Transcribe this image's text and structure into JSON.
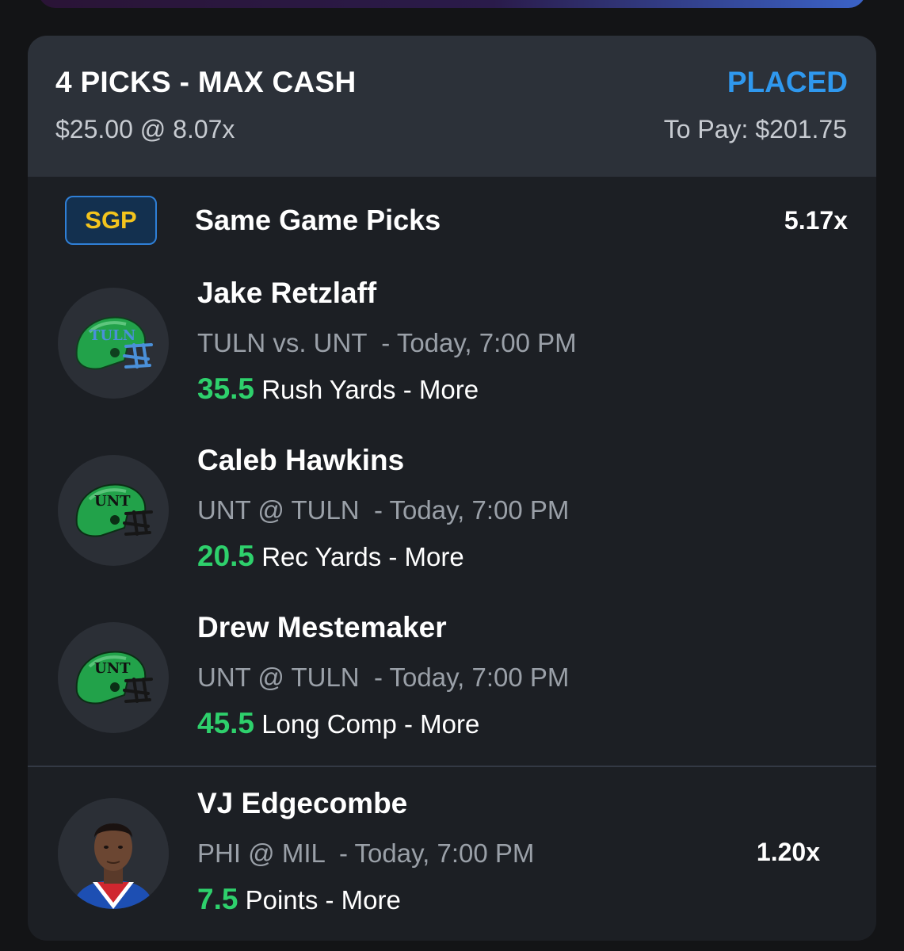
{
  "entry": {
    "title": "4 PICKS - MAX CASH",
    "wager": "$25.00 @ 8.07x",
    "status": "PLACED",
    "to_pay": "To Pay: $201.75"
  },
  "sgp": {
    "badge": "SGP",
    "title": "Same Game Picks",
    "multiplier": "5.17x"
  },
  "picks": [
    {
      "player": "Jake Retzlaff",
      "team_icon": "tuln-helmet",
      "matchup": "TULN vs. UNT",
      "time": "Today, 7:00 PM",
      "line": "35.5",
      "stat": "Rush Yards",
      "direction": "More"
    },
    {
      "player": "Caleb Hawkins",
      "team_icon": "unt-helmet",
      "matchup": "UNT @ TULN",
      "time": "Today, 7:00 PM",
      "line": "20.5",
      "stat": "Rec Yards",
      "direction": "More"
    },
    {
      "player": "Drew Mestemaker",
      "team_icon": "unt-helmet",
      "matchup": "UNT @ TULN",
      "time": "Today, 7:00 PM",
      "line": "45.5",
      "stat": "Long Comp",
      "direction": "More"
    },
    {
      "player": "VJ Edgecombe",
      "team_icon": "player-headshot",
      "matchup": "PHI @ MIL",
      "time": "Today, 7:00 PM",
      "line": "7.5",
      "stat": "Points",
      "direction": "More",
      "multiplier": "1.20x"
    }
  ],
  "helmet_labels": {
    "tuln": "TULN",
    "unt": "UNT"
  },
  "colors": {
    "accent_blue": "#2f98ee",
    "line_green": "#2ed06c",
    "badge_gold": "#f3c41d",
    "helmet_green": "#22a24a",
    "tuln_mask": "#4a90d9"
  }
}
